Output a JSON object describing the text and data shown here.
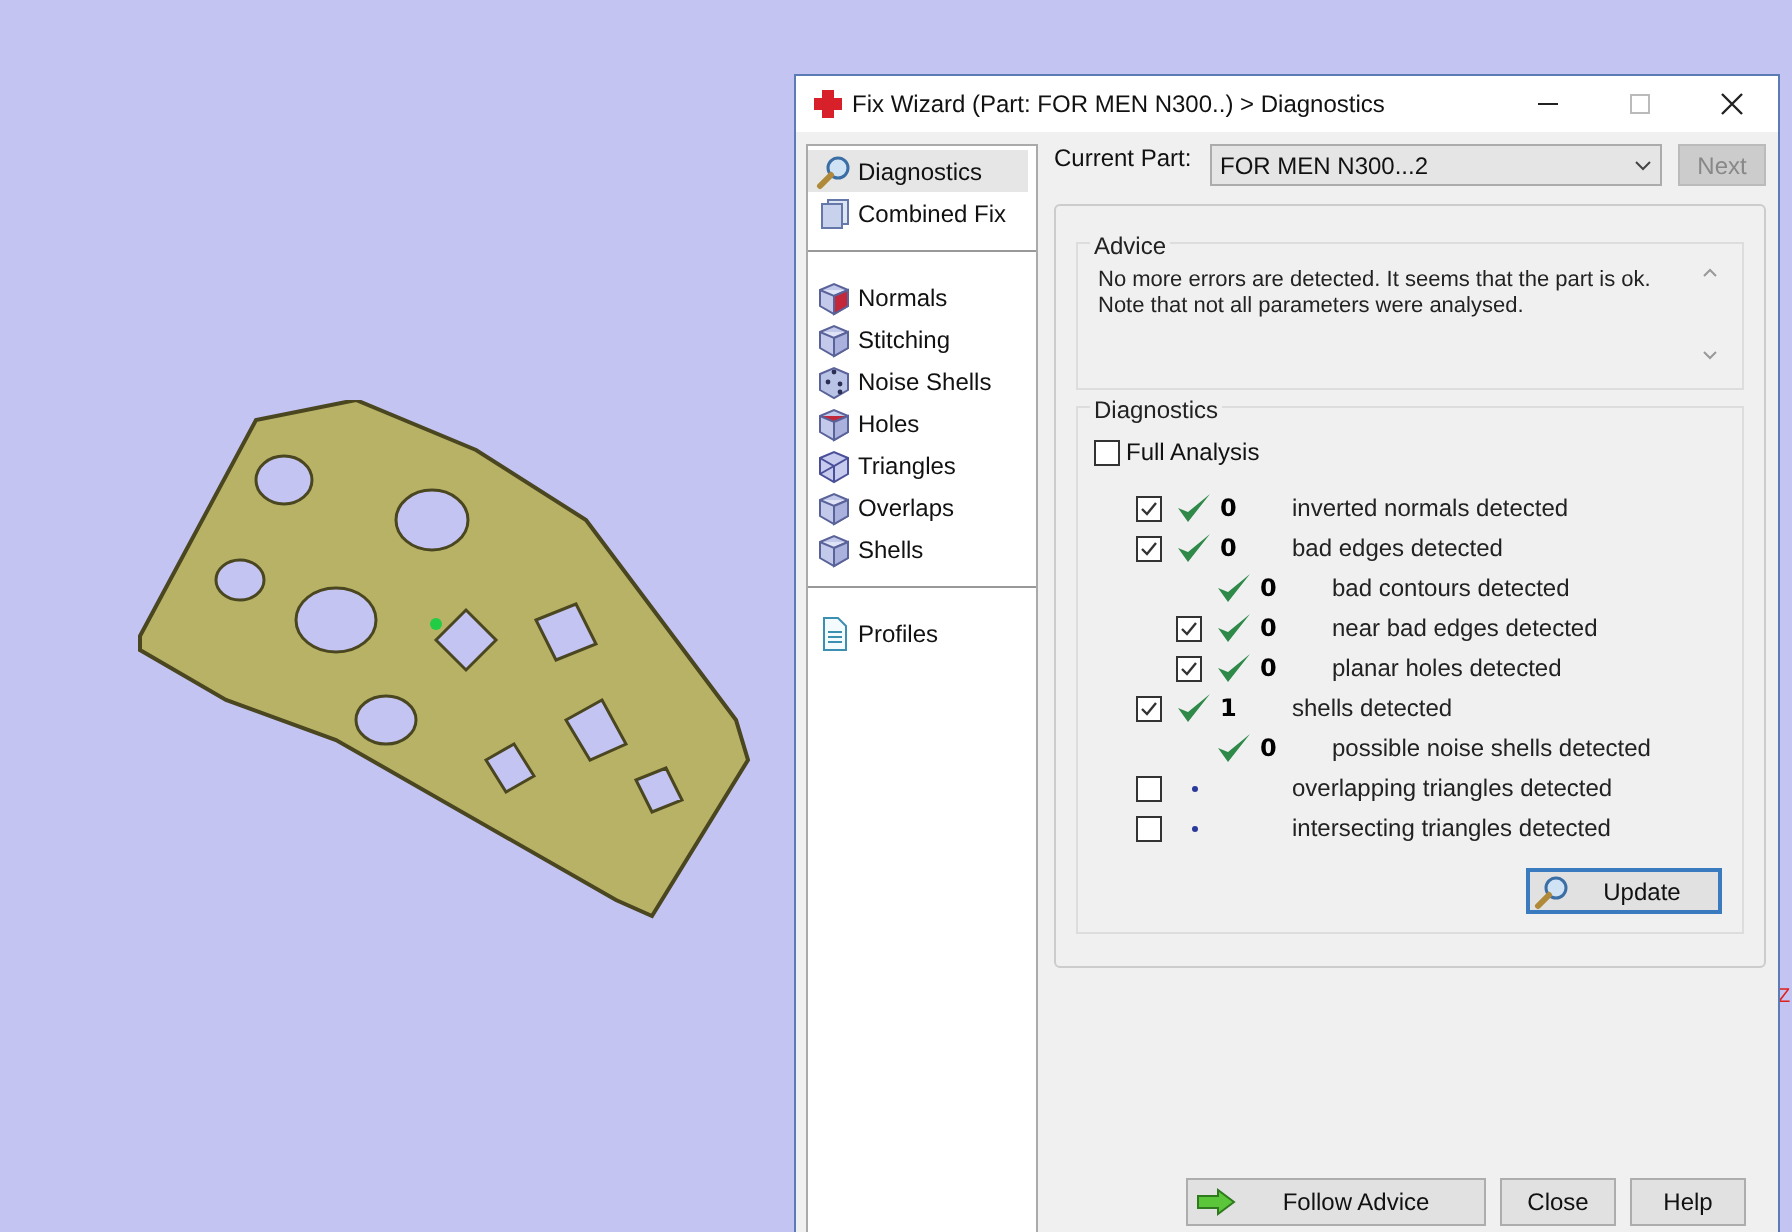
{
  "viewport": {
    "axis_label": "Z"
  },
  "window": {
    "title": "Fix Wizard (Part: FOR MEN N300..) > Diagnostics"
  },
  "nav": {
    "groups": [
      [
        {
          "label": "Diagnostics",
          "kind": "search",
          "selected": true
        },
        {
          "label": "Combined Fix",
          "kind": "pages",
          "selected": false
        }
      ],
      [
        {
          "label": "Normals",
          "kind": "cube-red-side",
          "selected": false
        },
        {
          "label": "Stitching",
          "kind": "cube",
          "selected": false
        },
        {
          "label": "Noise Shells",
          "kind": "dice",
          "selected": false
        },
        {
          "label": "Holes",
          "kind": "cube-red-top",
          "selected": false
        },
        {
          "label": "Triangles",
          "kind": "wire",
          "selected": false
        },
        {
          "label": "Overlaps",
          "kind": "cube",
          "selected": false
        },
        {
          "label": "Shells",
          "kind": "cube",
          "selected": false
        }
      ],
      [
        {
          "label": "Profiles",
          "kind": "document",
          "selected": false
        }
      ]
    ]
  },
  "current_part": {
    "label": "Current Part:",
    "value": "FOR MEN N300...2",
    "next_button": {
      "label": "Next",
      "disabled": true
    }
  },
  "advice": {
    "title": "Advice",
    "text": "No more errors are detected. It seems that the part is ok.\nNote that not all parameters were analysed."
  },
  "diagnostics": {
    "title": "Diagnostics",
    "full_analysis": {
      "label": "Full Analysis",
      "checked": false
    },
    "rows": [
      {
        "checked": true,
        "kind": "ok",
        "count": "0",
        "label": "inverted normals detected"
      },
      {
        "checked": true,
        "kind": "ok",
        "count": "0",
        "label": "bad edges detected",
        "children": [
          {
            "kind": "ok",
            "count": "0",
            "label": "bad contours detected"
          },
          {
            "checked": true,
            "kind": "ok",
            "count": "0",
            "label": "near bad edges detected"
          },
          {
            "checked": true,
            "kind": "ok",
            "count": "0",
            "label": "planar holes detected"
          }
        ]
      },
      {
        "checked": true,
        "kind": "ok",
        "count": "1",
        "label": "shells detected",
        "children": [
          {
            "kind": "ok",
            "count": "0",
            "label": "possible noise shells detected"
          }
        ]
      },
      {
        "checked": false,
        "kind": "pending",
        "label": "overlapping triangles detected"
      },
      {
        "checked": false,
        "kind": "pending",
        "label": "intersecting triangles detected"
      }
    ],
    "update_button": "Update"
  },
  "buttons": [
    {
      "label": "Follow Advice",
      "kind": "arrow"
    },
    {
      "label": "Close",
      "kind": "plain"
    },
    {
      "label": "Help",
      "kind": "plain"
    }
  ]
}
